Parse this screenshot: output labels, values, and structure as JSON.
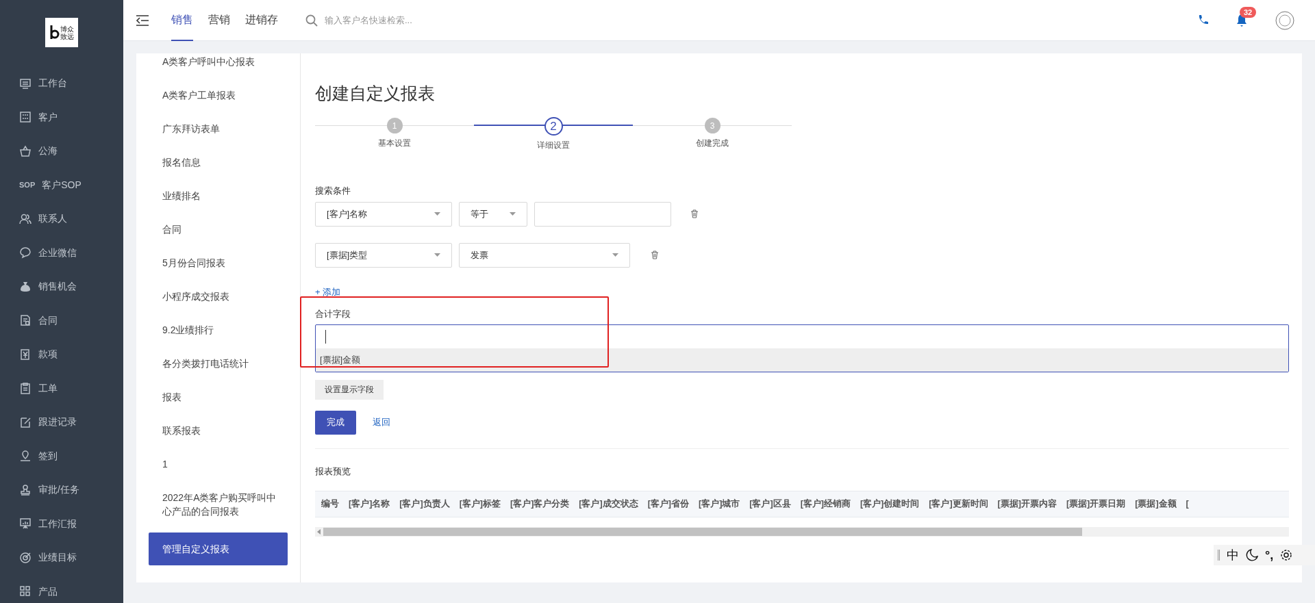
{
  "sidebar": {
    "logo": {
      "line1": "博众",
      "line2": "致远"
    },
    "items": [
      {
        "label": "工作台"
      },
      {
        "label": "客户"
      },
      {
        "label": "公海"
      },
      {
        "label": "客户SOP",
        "icon_text": "SOP"
      },
      {
        "label": "联系人"
      },
      {
        "label": "企业微信"
      },
      {
        "label": "销售机会"
      },
      {
        "label": "合同"
      },
      {
        "label": "款项"
      },
      {
        "label": "工单"
      },
      {
        "label": "跟进记录"
      },
      {
        "label": "签到"
      },
      {
        "label": "审批/任务"
      },
      {
        "label": "工作汇报"
      },
      {
        "label": "业绩目标"
      },
      {
        "label": "产品"
      }
    ]
  },
  "topbar": {
    "tabs": [
      {
        "label": "销售",
        "selected": true
      },
      {
        "label": "营销",
        "selected": false
      },
      {
        "label": "进销存",
        "selected": false
      }
    ],
    "search": {
      "placeholder": "输入客户名快速检索..."
    },
    "notifications": "32"
  },
  "report_list": [
    {
      "label": "A类客户呼叫中心报表",
      "selected": false
    },
    {
      "label": "A类客户工单报表",
      "selected": false
    },
    {
      "label": "广东拜访表单",
      "selected": false
    },
    {
      "label": "报名信息",
      "selected": false
    },
    {
      "label": "业绩排名",
      "selected": false
    },
    {
      "label": "合同",
      "selected": false
    },
    {
      "label": "5月份合同报表",
      "selected": false
    },
    {
      "label": "小程序成交报表",
      "selected": false
    },
    {
      "label": "9.2业绩排行",
      "selected": false
    },
    {
      "label": "各分类拨打电话统计",
      "selected": false
    },
    {
      "label": "报表",
      "selected": false
    },
    {
      "label": "联系报表",
      "selected": false
    },
    {
      "label": "1",
      "selected": false
    },
    {
      "label": "2022年A类客户购买呼叫中心产品的合同报表",
      "selected": false
    },
    {
      "label": "管理自定义报表",
      "selected": true
    }
  ],
  "form": {
    "title": "创建自定义报表",
    "steps": [
      {
        "number": "1",
        "label": "基本设置",
        "selected": false
      },
      {
        "number": "2",
        "label": "详细设置",
        "selected": true
      },
      {
        "number": "3",
        "label": "创建完成",
        "selected": false
      }
    ],
    "conditions_label": "搜索条件",
    "conditions": [
      {
        "field": "[客户]名称",
        "operator": "等于",
        "kind": "text"
      },
      {
        "field": "[票据]类型",
        "value": "发票",
        "kind": "select"
      }
    ],
    "add_link": "+ 添加",
    "sum_label": "合计字段",
    "sum_options": [
      "[票据]金额"
    ],
    "display_button": "设置显示字段",
    "finish_button": "完成",
    "back_link": "返回",
    "preview_label": "报表预览",
    "columns": [
      "编号",
      "[客户]名称",
      "[客户]负责人",
      "[客户]标签",
      "[客户]客户分类",
      "[客户]成交状态",
      "[客户]省份",
      "[客户]城市",
      "[客户]区县",
      "[客户]经销商",
      "[客户]创建时间",
      "[客户]更新时间",
      "[票据]开票内容",
      "[票据]开票日期",
      "[票据]金额",
      "["
    ]
  },
  "ime": {
    "mode": "中",
    "punct": "°,"
  }
}
